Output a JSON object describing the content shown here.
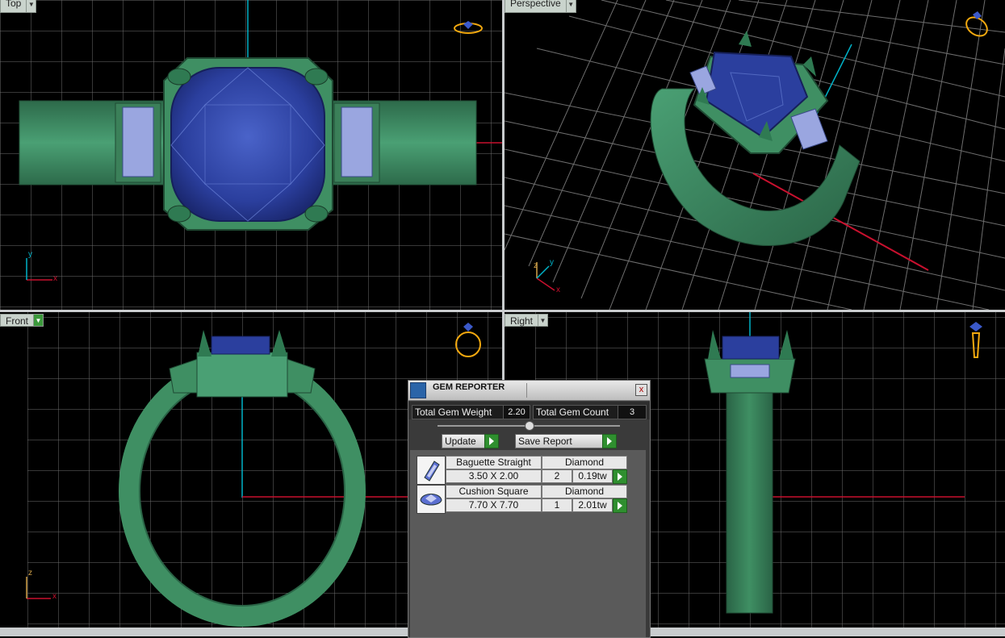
{
  "viewports": {
    "top": {
      "label": "Top"
    },
    "perspective": {
      "label": "Perspective"
    },
    "front": {
      "label": "Front"
    },
    "right": {
      "label": "Right"
    }
  },
  "axes": {
    "x": "x",
    "y": "y",
    "z": "z"
  },
  "gem_reporter": {
    "title": "GEM REPORTER",
    "close": "x",
    "total_weight_label": "Total Gem Weight",
    "total_weight_value": "2.20",
    "total_count_label": "Total Gem Count",
    "total_count_value": "3",
    "update_label": "Update",
    "save_report_label": "Save Report",
    "gems": [
      {
        "shape": "Baguette Straight",
        "type": "Diamond",
        "size": "3.50 X 2.00",
        "count": "2",
        "weight": "0.19tw",
        "icon": "baguette-gem-icon"
      },
      {
        "shape": "Cushion Square",
        "type": "Diamond",
        "size": "7.70 X 7.70",
        "count": "1",
        "weight": "2.01tw",
        "icon": "cushion-gem-icon"
      }
    ]
  },
  "colors": {
    "metal": "#3f8f63",
    "gem": "#2b3f9e",
    "baguette": "#9aa6e0",
    "grid": "#6e6e6e",
    "axis_x": "#c8102e",
    "axis_y": "#00b3c8"
  }
}
